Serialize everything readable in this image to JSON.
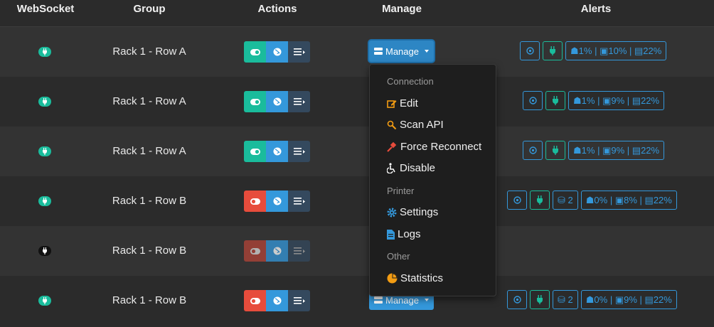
{
  "header": {
    "websocket": "WebSocket",
    "group": "Group",
    "actions": "Actions",
    "manage": "Manage",
    "alerts": "Alerts"
  },
  "rows": [
    {
      "group": "Rack 1 - Row A",
      "ws": "connected",
      "toggle": "on",
      "alerts": {
        "usb": null,
        "gpu": "1%",
        "cpu": "10%",
        "ram": "22%"
      }
    },
    {
      "group": "Rack 1 - Row A",
      "ws": "connected",
      "toggle": "on",
      "alerts": {
        "usb": null,
        "gpu": "1%",
        "cpu": "9%",
        "ram": "22%"
      }
    },
    {
      "group": "Rack 1 - Row A",
      "ws": "connected",
      "toggle": "on",
      "alerts": {
        "usb": null,
        "gpu": "1%",
        "cpu": "9%",
        "ram": "22%"
      }
    },
    {
      "group": "Rack 1 - Row B",
      "ws": "connected",
      "toggle": "off",
      "alerts": {
        "usb": "2",
        "gpu": "0%",
        "cpu": "8%",
        "ram": "22%"
      }
    },
    {
      "group": "Rack 1 - Row B",
      "ws": "disconnected",
      "toggle": "disabled",
      "alerts": null
    },
    {
      "group": "Rack 1 - Row B",
      "ws": "connected",
      "toggle": "off",
      "alerts": {
        "usb": "2",
        "gpu": "0%",
        "cpu": "9%",
        "ram": "22%"
      }
    }
  ],
  "manage_label": "Manage",
  "menu": {
    "connection_header": "Connection",
    "edit": "Edit",
    "scan_api": "Scan API",
    "force_reconnect": "Force Reconnect",
    "disable": "Disable",
    "printer_header": "Printer",
    "settings": "Settings",
    "logs": "Logs",
    "other_header": "Other",
    "statistics": "Statistics"
  },
  "colors": {
    "teal": "#1abc9c",
    "blue": "#3498db",
    "red": "#e74c3c",
    "navy": "#34495e",
    "orange": "#f39c12"
  }
}
